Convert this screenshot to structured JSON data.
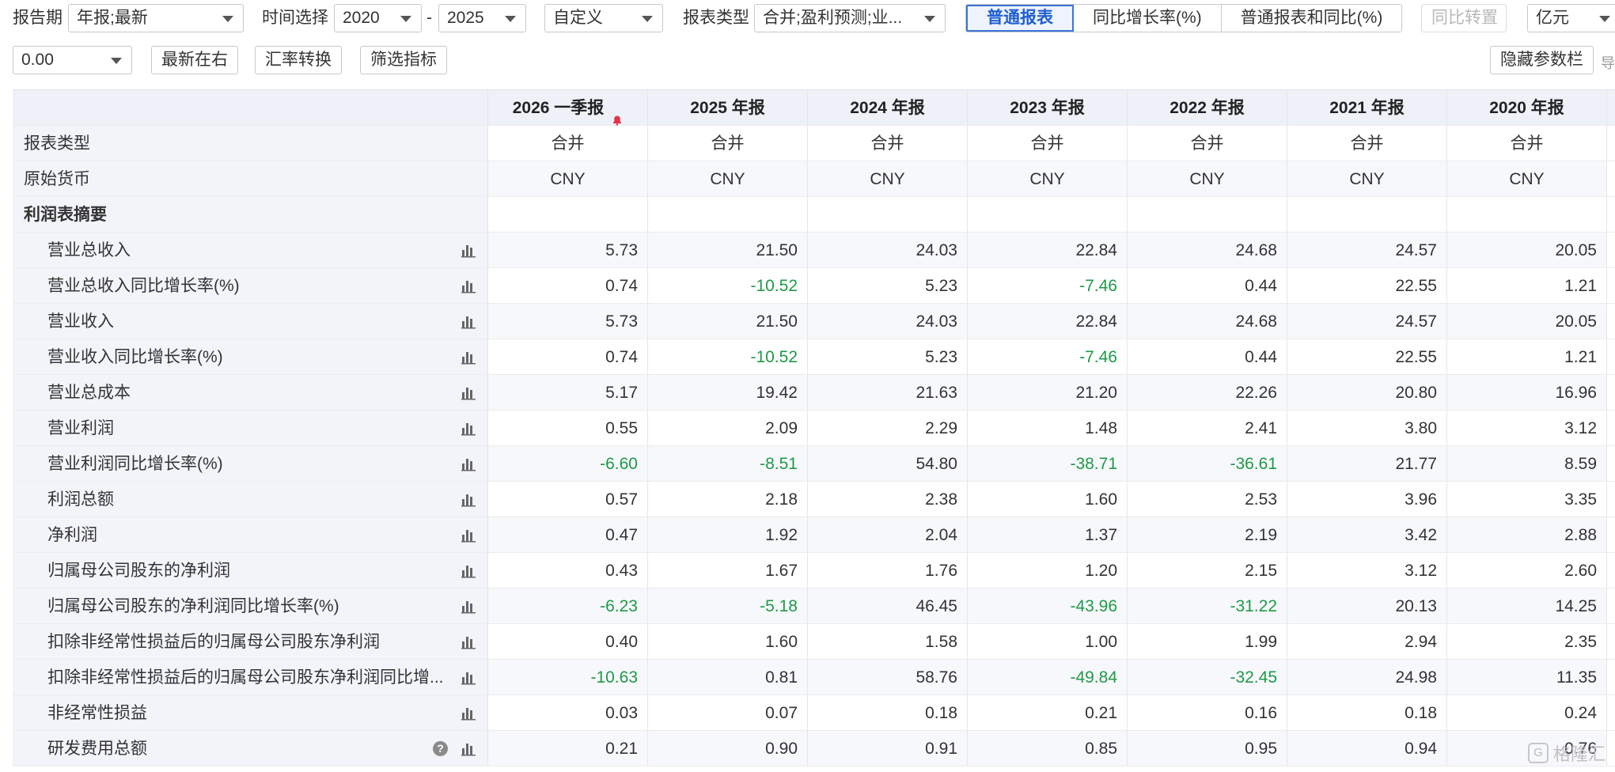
{
  "toolbar": {
    "period_label": "报告期",
    "period_value": "年报;最新",
    "time_label": "时间选择",
    "time_from": "2020",
    "time_dash": "-",
    "time_to": "2025",
    "custom_value": "自定义",
    "report_type_label": "报表类型",
    "report_type_value": "合并;盈利预测;业...",
    "view_tabs": [
      "普通报表",
      "同比增长率(%)",
      "普通报表和同比(%)"
    ],
    "active_tab_index": 0,
    "yoy_transpose": "同比转置",
    "unit_value": "亿元",
    "precision_value": "0.00",
    "latest_right": "最新在右",
    "fx_convert": "汇率转换",
    "filter_metrics": "筛选指标",
    "hide_params": "隐藏参数栏",
    "edge_char": "导"
  },
  "table": {
    "columns": [
      "2026 一季报",
      "2025 年报",
      "2024 年报",
      "2023 年报",
      "2022 年报",
      "2021 年报",
      "2020 年报"
    ],
    "rows": [
      {
        "label": "报表类型",
        "type": "meta",
        "values": [
          "合并",
          "合并",
          "合并",
          "合并",
          "合并",
          "合并",
          "合并"
        ]
      },
      {
        "label": "原始货币",
        "type": "meta",
        "values": [
          "CNY",
          "CNY",
          "CNY",
          "CNY",
          "CNY",
          "CNY",
          "CNY"
        ]
      },
      {
        "label": "利润表摘要",
        "type": "section",
        "values": [
          "",
          "",
          "",
          "",
          "",
          "",
          ""
        ]
      },
      {
        "label": "营业总收入",
        "type": "data",
        "values": [
          "5.73",
          "21.50",
          "24.03",
          "22.84",
          "24.68",
          "24.57",
          "20.05"
        ]
      },
      {
        "label": "营业总收入同比增长率(%)",
        "type": "data",
        "values": [
          "0.74",
          "-10.52",
          "5.23",
          "-7.46",
          "0.44",
          "22.55",
          "1.21"
        ]
      },
      {
        "label": "营业收入",
        "type": "data",
        "values": [
          "5.73",
          "21.50",
          "24.03",
          "22.84",
          "24.68",
          "24.57",
          "20.05"
        ]
      },
      {
        "label": "营业收入同比增长率(%)",
        "type": "data",
        "values": [
          "0.74",
          "-10.52",
          "5.23",
          "-7.46",
          "0.44",
          "22.55",
          "1.21"
        ]
      },
      {
        "label": "营业总成本",
        "type": "data",
        "values": [
          "5.17",
          "19.42",
          "21.63",
          "21.20",
          "22.26",
          "20.80",
          "16.96"
        ]
      },
      {
        "label": "营业利润",
        "type": "data",
        "values": [
          "0.55",
          "2.09",
          "2.29",
          "1.48",
          "2.41",
          "3.80",
          "3.12"
        ]
      },
      {
        "label": "营业利润同比增长率(%)",
        "type": "data",
        "values": [
          "-6.60",
          "-8.51",
          "54.80",
          "-38.71",
          "-36.61",
          "21.77",
          "8.59"
        ]
      },
      {
        "label": "利润总额",
        "type": "data",
        "values": [
          "0.57",
          "2.18",
          "2.38",
          "1.60",
          "2.53",
          "3.96",
          "3.35"
        ]
      },
      {
        "label": "净利润",
        "type": "data",
        "values": [
          "0.47",
          "1.92",
          "2.04",
          "1.37",
          "2.19",
          "3.42",
          "2.88"
        ]
      },
      {
        "label": "归属母公司股东的净利润",
        "type": "data",
        "values": [
          "0.43",
          "1.67",
          "1.76",
          "1.20",
          "2.15",
          "3.12",
          "2.60"
        ]
      },
      {
        "label": "归属母公司股东的净利润同比增长率(%)",
        "type": "data",
        "values": [
          "-6.23",
          "-5.18",
          "46.45",
          "-43.96",
          "-31.22",
          "20.13",
          "14.25"
        ]
      },
      {
        "label": "扣除非经常性损益后的归属母公司股东净利润",
        "type": "data",
        "values": [
          "0.40",
          "1.60",
          "1.58",
          "1.00",
          "1.99",
          "2.94",
          "2.35"
        ]
      },
      {
        "label": "扣除非经常性损益后的归属母公司股东净利润同比增...",
        "type": "data",
        "values": [
          "-10.63",
          "0.81",
          "58.76",
          "-49.84",
          "-32.45",
          "24.98",
          "11.35"
        ]
      },
      {
        "label": "非经常性损益",
        "type": "data",
        "values": [
          "0.03",
          "0.07",
          "0.18",
          "0.21",
          "0.16",
          "0.18",
          "0.24"
        ]
      },
      {
        "label": "研发费用总额",
        "type": "data",
        "help": "?",
        "values": [
          "0.21",
          "0.90",
          "0.91",
          "0.85",
          "0.95",
          "0.94",
          "0.76"
        ]
      }
    ]
  },
  "watermark": {
    "text": "格隆汇",
    "logo": "G"
  },
  "colors": {
    "negative": "#1e9a48",
    "active_tab": "#3b74d8",
    "bell": "#e5334b"
  }
}
